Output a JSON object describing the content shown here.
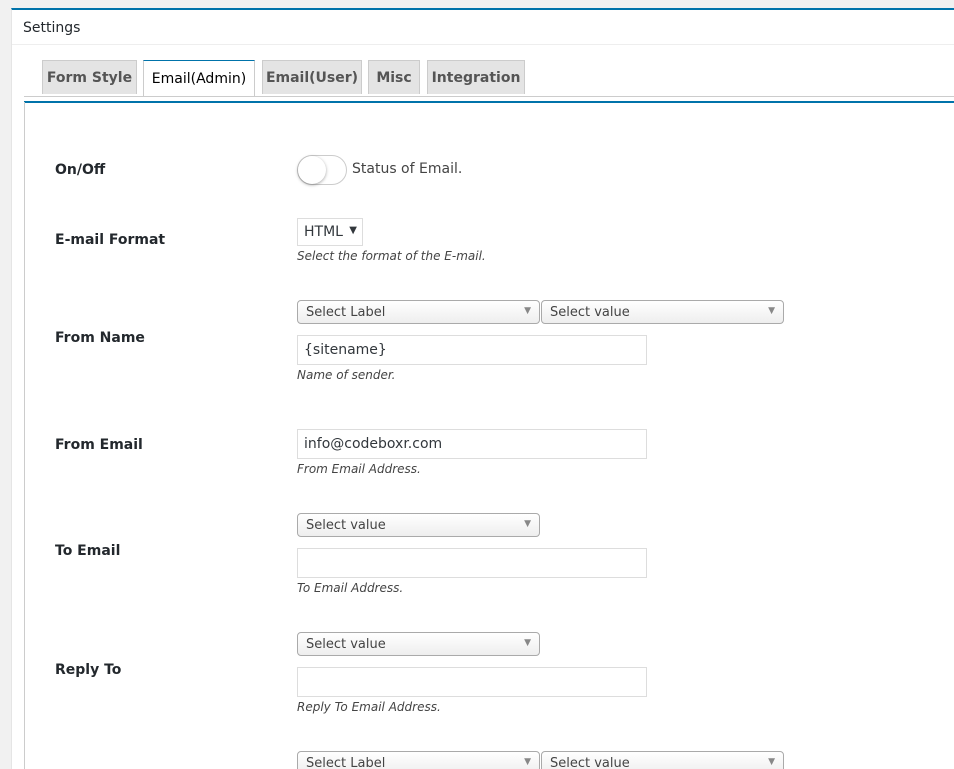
{
  "panel": {
    "title": "Settings"
  },
  "tabs": [
    {
      "label": "Form Style"
    },
    {
      "label": "Email(Admin)"
    },
    {
      "label": "Email(User)"
    },
    {
      "label": "Misc"
    },
    {
      "label": "Integration"
    }
  ],
  "active_tab": "Email(Admin)",
  "fields": {
    "onoff": {
      "label": "On/Off",
      "inline_text": "Status of Email.",
      "enabled": false
    },
    "format": {
      "label": "E-mail Format",
      "value": "HTML",
      "desc": "Select the format of the E-mail."
    },
    "from_name": {
      "label": "From Name",
      "select_label": "Select Label",
      "select_value": "Select value",
      "value": "{sitename}",
      "desc": "Name of sender."
    },
    "from_email": {
      "label": "From Email",
      "value": "info@codeboxr.com",
      "desc": "From Email Address."
    },
    "to_email": {
      "label": "To Email",
      "select_value": "Select value",
      "value": "",
      "desc": "To Email Address."
    },
    "reply_to": {
      "label": "Reply To",
      "select_value": "Select value",
      "value": "",
      "desc": "Reply To Email Address."
    },
    "next_row": {
      "select_label": "Select Label",
      "select_value": "Select value"
    }
  },
  "colors": {
    "accent": "#0073aa",
    "tab_bg": "#e4e4e4"
  }
}
